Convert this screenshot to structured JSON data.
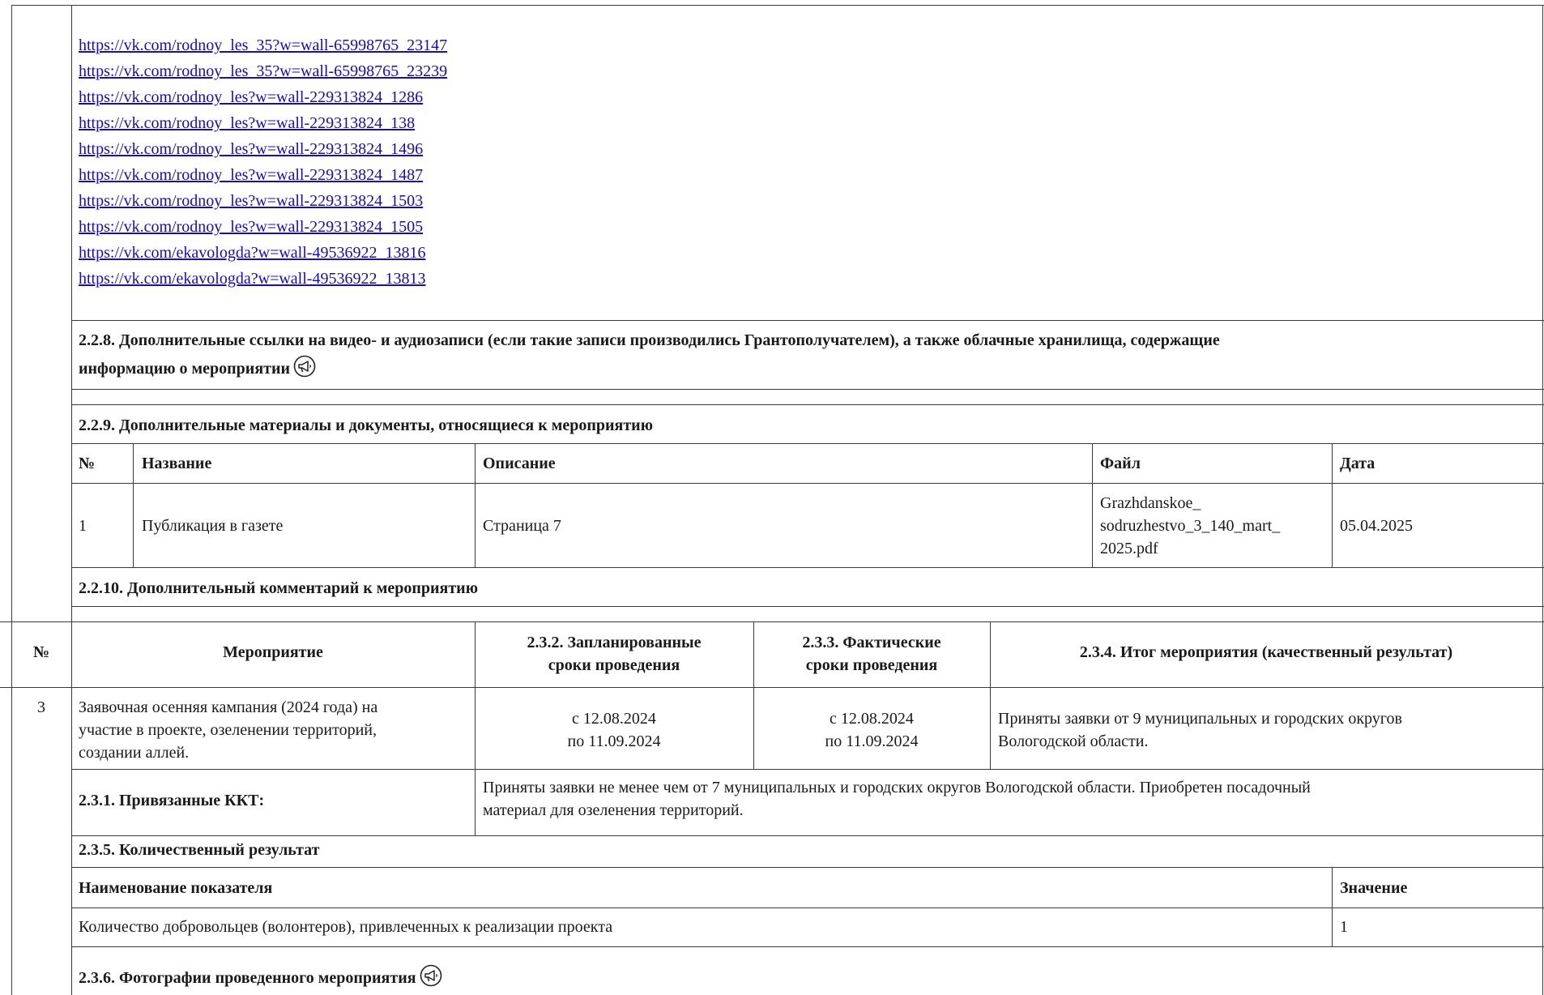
{
  "links": [
    "https://vk.com/rodnoy_les_35?w=wall-65998765_23147",
    "https://vk.com/rodnoy_les_35?w=wall-65998765_23239",
    "https://vk.com/rodnoy_les?w=wall-229313824_1286",
    "https://vk.com/rodnoy_les?w=wall-229313824_138",
    "https://vk.com/rodnoy_les?w=wall-229313824_1496",
    "https://vk.com/rodnoy_les?w=wall-229313824_1487",
    "https://vk.com/rodnoy_les?w=wall-229313824_1503",
    "https://vk.com/rodnoy_les?w=wall-229313824_1505",
    "https://vk.com/ekavologda?w=wall-49536922_13816",
    "https://vk.com/ekavologda?w=wall-49536922_13813"
  ],
  "s228": {
    "line1": "2.2.8. Дополнительные ссылки на видео- и аудиозаписи (если такие записи производились Грантополучателем), а также облачные хранилища, содержащие",
    "line2": "информацию о мероприятии",
    "icon": "megaphone-icon"
  },
  "s229": {
    "title": "2.2.9. Дополнительные материалы и документы, относящиеся к мероприятию",
    "headers": {
      "num": "№",
      "name": "Название",
      "desc": "Описание",
      "file": "Файл",
      "date": "Дата"
    },
    "row": {
      "num": "1",
      "name": "Публикация в газете",
      "desc": "Страница 7",
      "file_l1": "Grazhdanskoe_",
      "file_l2": "sodruzhestvo_3_140_mart_",
      "file_l3": "2025.pdf",
      "date": "05.04.2025"
    }
  },
  "s2210": {
    "title": "2.2.10. Дополнительный комментарий к мероприятию"
  },
  "events_header": {
    "num": "№",
    "event": "Мероприятие",
    "planned_l1": "2.3.2. Запланированные",
    "planned_l2": "сроки проведения",
    "actual_l1": "2.3.3. Фактические",
    "actual_l2": "сроки проведения",
    "result": "2.3.4. Итог мероприятия (качественный результат)"
  },
  "event3": {
    "num": "3",
    "name_l1": "Заявочная осенняя кампания (2024 года) на",
    "name_l2": "участие в проекте, озеленении территорий,",
    "name_l3": "создании аллей.",
    "planned_from": "с 12.08.2024",
    "planned_to": "по 11.09.2024",
    "actual_from": "с 12.08.2024",
    "actual_to": "по 11.09.2024",
    "result_l1": "Приняты заявки от 9 муниципальных и городских округов",
    "result_l2": "Вологодской области.",
    "kkt_label": "2.3.1. Привязанные ККТ:",
    "kkt_l1": "Приняты заявки не менее чем от 7 муниципальных и городских округов Вологодской области. Приобретен посадочный",
    "kkt_l2": "материал для озеленения территорий.",
    "quant_title": "2.3.5. Количественный результат",
    "quant_header_name": "Наименование показателя",
    "quant_header_value": "Значение",
    "quant_row_name": "Количество добровольцев (волонтеров), привлеченных к реализации проекта",
    "quant_row_value": "1",
    "photos_title": "2.3.6. Фотографии проведенного мероприятия",
    "photos_icon": "megaphone-icon"
  }
}
